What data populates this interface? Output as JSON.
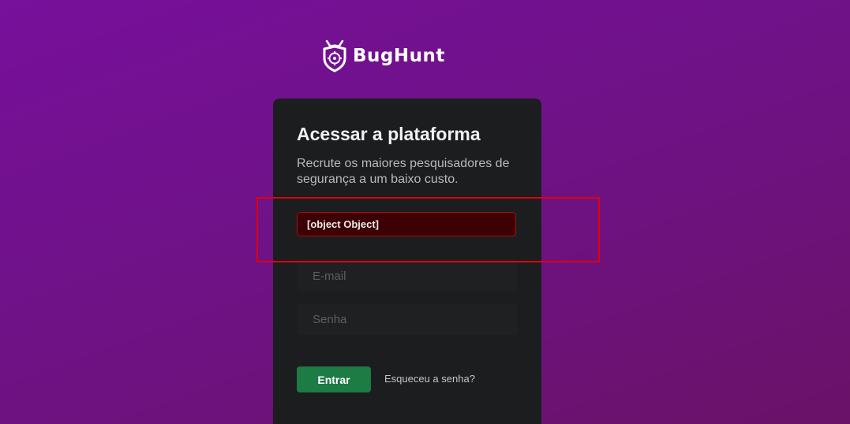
{
  "brand": {
    "name": "BugHunt",
    "logo_icon": "shield-bug-target-icon"
  },
  "login": {
    "title": "Acessar a plataforma",
    "subtitle": "Recrute os maiores pesquisadores de segurança a um baixo custo.",
    "error_message": "[object Object]",
    "email_placeholder": "E-mail",
    "email_value": "",
    "password_placeholder": "Senha",
    "password_value": "",
    "submit_label": "Entrar",
    "forgot_password_label": "Esqueceu a senha?"
  },
  "colors": {
    "background_start": "#77109b",
    "background_end": "#6a1268",
    "card": "#1c1d1f",
    "error_background": "#3d0004",
    "error_border": "#a40f16",
    "primary_button": "#1d7b44",
    "highlight_box": "#e0000f"
  },
  "annotation": {
    "highlight_target": "error_message"
  }
}
